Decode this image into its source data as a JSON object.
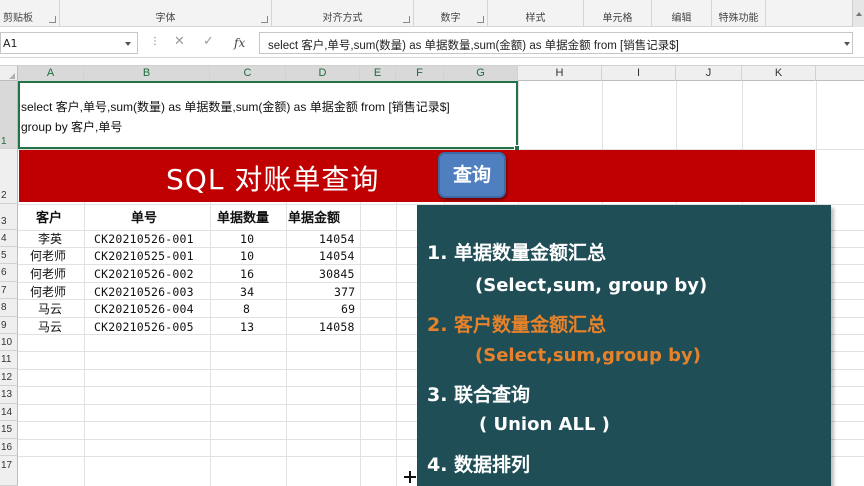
{
  "ribbon": {
    "groups": [
      "剪贴板",
      "字体",
      "对齐方式",
      "数字",
      "样式",
      "单元格",
      "编辑",
      "特殊功能"
    ]
  },
  "formula_bar": {
    "name_box": "A1",
    "cancel_icon": "✕",
    "enter_icon": "✓",
    "fx_label": "fx",
    "formula": "select 客户,单号,sum(数量) as 单据数量,sum(金额) as 单据金额 from [销售记录$]"
  },
  "columns": [
    "A",
    "B",
    "C",
    "D",
    "E",
    "F",
    "G",
    "H",
    "I",
    "J",
    "K"
  ],
  "rows": [
    "1",
    "2",
    "3",
    "4",
    "5",
    "6",
    "7",
    "8",
    "9",
    "10",
    "11",
    "12",
    "13",
    "14",
    "15",
    "16",
    "17"
  ],
  "sql_cell": {
    "line1": "select 客户,单号,sum(数量) as 单据数量,sum(金额) as 单据金额 from [销售记录$]",
    "line2": "group by 客户,单号"
  },
  "banner": {
    "title": "SQL 对账单查询",
    "button": "查询"
  },
  "table": {
    "headers": [
      "客户",
      "单号",
      "单据数量",
      "单据金额"
    ],
    "rows": [
      [
        "李英",
        "CK20210526-001",
        "10",
        "14054"
      ],
      [
        "何老师",
        "CK20210525-001",
        "10",
        "14054"
      ],
      [
        "何老师",
        "CK20210526-002",
        "16",
        "30845"
      ],
      [
        "何老师",
        "CK20210526-003",
        "34",
        "377"
      ],
      [
        "马云",
        "CK20210526-004",
        "8",
        "69"
      ],
      [
        "马云",
        "CK20210526-005",
        "13",
        "14058"
      ]
    ]
  },
  "panel": {
    "items": [
      "1. 单据数量金额汇总",
      "(Select,sum, group by)",
      "2. 客户数量金额汇总",
      "(Select,sum,group by)",
      "3. 联合查询",
      "( Union ALL )",
      "4. 数据排列"
    ],
    "highlight_color": "#e6822a",
    "background_color": "#1f4e57"
  },
  "colors": {
    "banner": "#c00000",
    "button": "#4f7fbf",
    "selection": "#217346"
  }
}
